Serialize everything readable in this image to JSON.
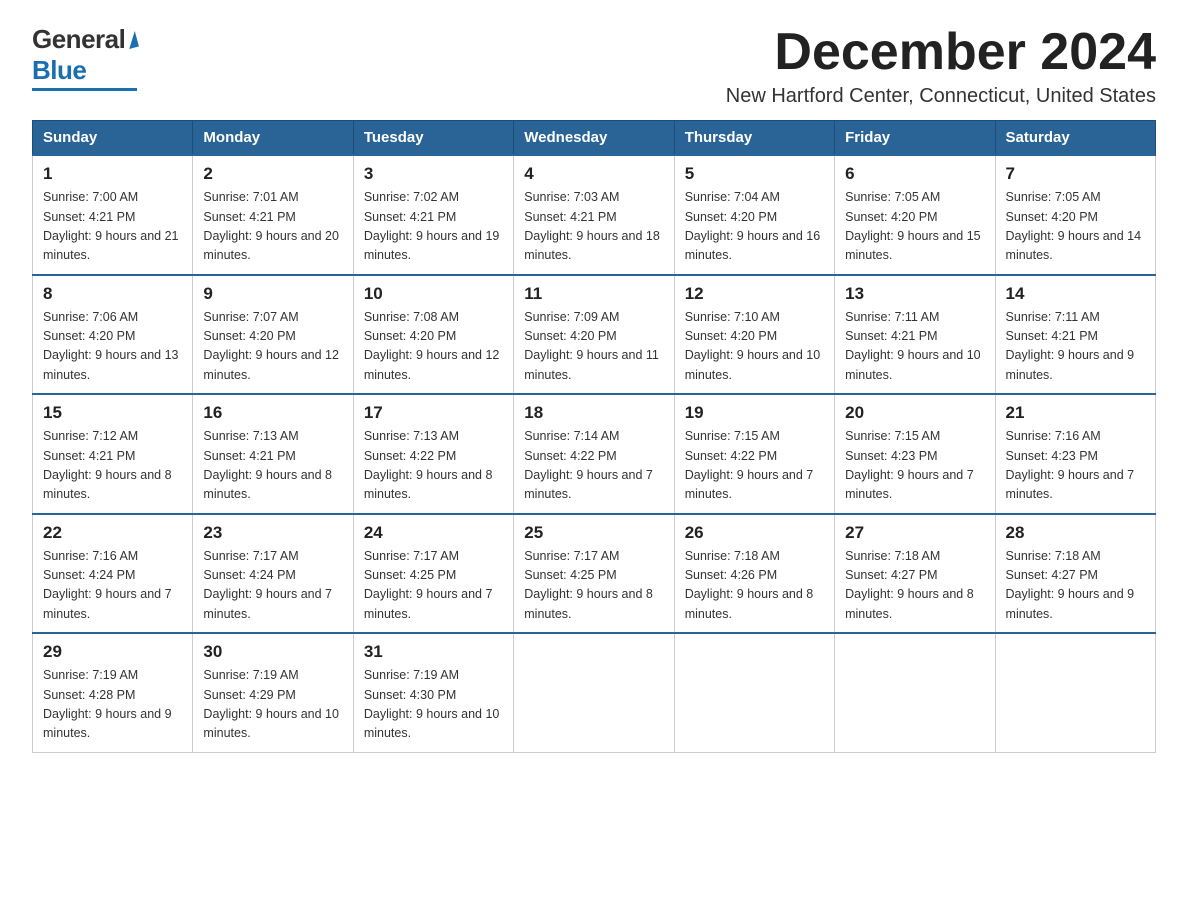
{
  "logo": {
    "general": "General",
    "blue": "Blue"
  },
  "header": {
    "month_year": "December 2024",
    "location": "New Hartford Center, Connecticut, United States"
  },
  "weekdays": [
    "Sunday",
    "Monday",
    "Tuesday",
    "Wednesday",
    "Thursday",
    "Friday",
    "Saturday"
  ],
  "weeks": [
    [
      {
        "day": "1",
        "sunrise": "7:00 AM",
        "sunset": "4:21 PM",
        "daylight": "9 hours and 21 minutes."
      },
      {
        "day": "2",
        "sunrise": "7:01 AM",
        "sunset": "4:21 PM",
        "daylight": "9 hours and 20 minutes."
      },
      {
        "day": "3",
        "sunrise": "7:02 AM",
        "sunset": "4:21 PM",
        "daylight": "9 hours and 19 minutes."
      },
      {
        "day": "4",
        "sunrise": "7:03 AM",
        "sunset": "4:21 PM",
        "daylight": "9 hours and 18 minutes."
      },
      {
        "day": "5",
        "sunrise": "7:04 AM",
        "sunset": "4:20 PM",
        "daylight": "9 hours and 16 minutes."
      },
      {
        "day": "6",
        "sunrise": "7:05 AM",
        "sunset": "4:20 PM",
        "daylight": "9 hours and 15 minutes."
      },
      {
        "day": "7",
        "sunrise": "7:05 AM",
        "sunset": "4:20 PM",
        "daylight": "9 hours and 14 minutes."
      }
    ],
    [
      {
        "day": "8",
        "sunrise": "7:06 AM",
        "sunset": "4:20 PM",
        "daylight": "9 hours and 13 minutes."
      },
      {
        "day": "9",
        "sunrise": "7:07 AM",
        "sunset": "4:20 PM",
        "daylight": "9 hours and 12 minutes."
      },
      {
        "day": "10",
        "sunrise": "7:08 AM",
        "sunset": "4:20 PM",
        "daylight": "9 hours and 12 minutes."
      },
      {
        "day": "11",
        "sunrise": "7:09 AM",
        "sunset": "4:20 PM",
        "daylight": "9 hours and 11 minutes."
      },
      {
        "day": "12",
        "sunrise": "7:10 AM",
        "sunset": "4:20 PM",
        "daylight": "9 hours and 10 minutes."
      },
      {
        "day": "13",
        "sunrise": "7:11 AM",
        "sunset": "4:21 PM",
        "daylight": "9 hours and 10 minutes."
      },
      {
        "day": "14",
        "sunrise": "7:11 AM",
        "sunset": "4:21 PM",
        "daylight": "9 hours and 9 minutes."
      }
    ],
    [
      {
        "day": "15",
        "sunrise": "7:12 AM",
        "sunset": "4:21 PM",
        "daylight": "9 hours and 8 minutes."
      },
      {
        "day": "16",
        "sunrise": "7:13 AM",
        "sunset": "4:21 PM",
        "daylight": "9 hours and 8 minutes."
      },
      {
        "day": "17",
        "sunrise": "7:13 AM",
        "sunset": "4:22 PM",
        "daylight": "9 hours and 8 minutes."
      },
      {
        "day": "18",
        "sunrise": "7:14 AM",
        "sunset": "4:22 PM",
        "daylight": "9 hours and 7 minutes."
      },
      {
        "day": "19",
        "sunrise": "7:15 AM",
        "sunset": "4:22 PM",
        "daylight": "9 hours and 7 minutes."
      },
      {
        "day": "20",
        "sunrise": "7:15 AM",
        "sunset": "4:23 PM",
        "daylight": "9 hours and 7 minutes."
      },
      {
        "day": "21",
        "sunrise": "7:16 AM",
        "sunset": "4:23 PM",
        "daylight": "9 hours and 7 minutes."
      }
    ],
    [
      {
        "day": "22",
        "sunrise": "7:16 AM",
        "sunset": "4:24 PM",
        "daylight": "9 hours and 7 minutes."
      },
      {
        "day": "23",
        "sunrise": "7:17 AM",
        "sunset": "4:24 PM",
        "daylight": "9 hours and 7 minutes."
      },
      {
        "day": "24",
        "sunrise": "7:17 AM",
        "sunset": "4:25 PM",
        "daylight": "9 hours and 7 minutes."
      },
      {
        "day": "25",
        "sunrise": "7:17 AM",
        "sunset": "4:25 PM",
        "daylight": "9 hours and 8 minutes."
      },
      {
        "day": "26",
        "sunrise": "7:18 AM",
        "sunset": "4:26 PM",
        "daylight": "9 hours and 8 minutes."
      },
      {
        "day": "27",
        "sunrise": "7:18 AM",
        "sunset": "4:27 PM",
        "daylight": "9 hours and 8 minutes."
      },
      {
        "day": "28",
        "sunrise": "7:18 AM",
        "sunset": "4:27 PM",
        "daylight": "9 hours and 9 minutes."
      }
    ],
    [
      {
        "day": "29",
        "sunrise": "7:19 AM",
        "sunset": "4:28 PM",
        "daylight": "9 hours and 9 minutes."
      },
      {
        "day": "30",
        "sunrise": "7:19 AM",
        "sunset": "4:29 PM",
        "daylight": "9 hours and 10 minutes."
      },
      {
        "day": "31",
        "sunrise": "7:19 AM",
        "sunset": "4:30 PM",
        "daylight": "9 hours and 10 minutes."
      },
      null,
      null,
      null,
      null
    ]
  ]
}
